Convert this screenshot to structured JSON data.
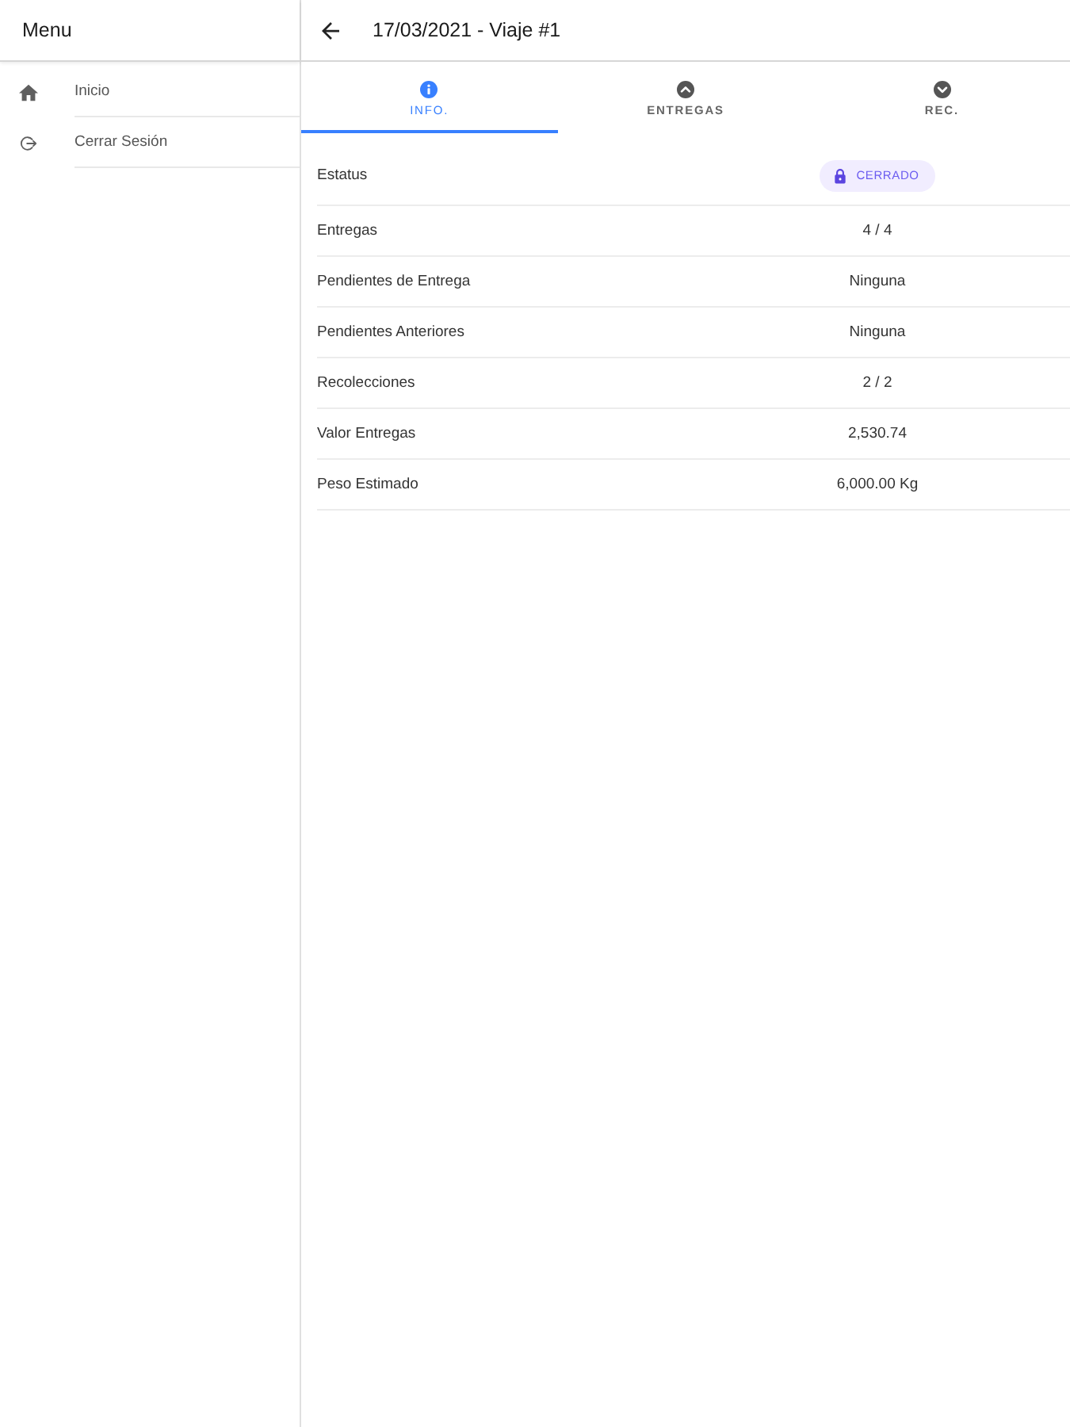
{
  "sidebar": {
    "title": "Menu",
    "items": [
      {
        "label": "Inicio"
      },
      {
        "label": "Cerrar Sesión"
      }
    ]
  },
  "header": {
    "title": "17/03/2021 - Viaje #1"
  },
  "tabs": [
    {
      "label": "INFO.",
      "selected": true
    },
    {
      "label": "ENTREGAS",
      "selected": false
    },
    {
      "label": "REC.",
      "selected": false
    }
  ],
  "rows": [
    {
      "label": "Estatus",
      "value": "CERRADO",
      "kind": "chip"
    },
    {
      "label": "Entregas",
      "value": "4 / 4",
      "kind": "text"
    },
    {
      "label": "Pendientes de Entrega",
      "value": "Ninguna",
      "kind": "text"
    },
    {
      "label": "Pendientes Anteriores",
      "value": "Ninguna",
      "kind": "text"
    },
    {
      "label": "Recolecciones",
      "value": "2 / 2",
      "kind": "text"
    },
    {
      "label": "Valor Entregas",
      "value": "2,530.74",
      "kind": "text"
    },
    {
      "label": "Peso Estimado",
      "value": "6,000.00 Kg",
      "kind": "text"
    }
  ]
}
